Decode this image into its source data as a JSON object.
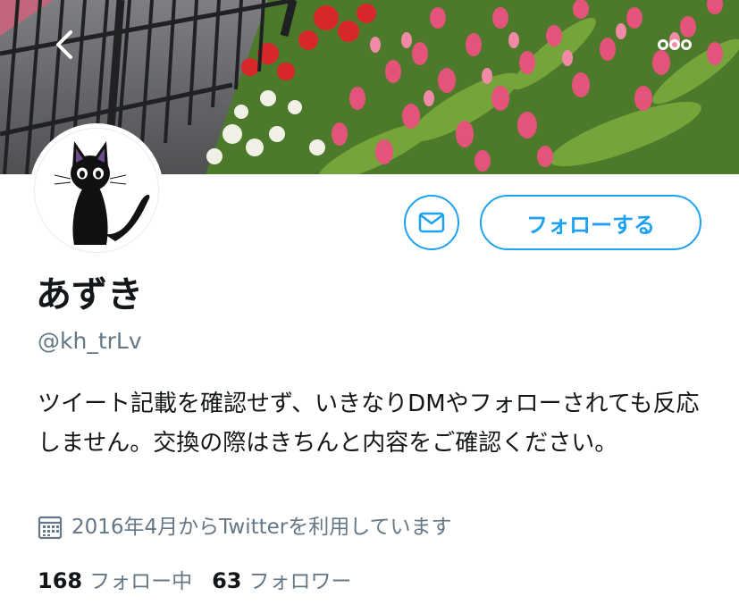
{
  "profile": {
    "display_name": "あずき",
    "handle": "@kh_trLv",
    "bio": "ツイート記載を確認せず、いきなりDMやフォローされても反応しません。交換の際はきちんと内容をご確認ください。",
    "joined": "2016年4月からTwitterを利用しています"
  },
  "actions": {
    "follow_label": "フォローする"
  },
  "stats": {
    "following_count": "168",
    "following_label": "フォロー中",
    "followers_count": "63",
    "followers_label": "フォロワー"
  },
  "icons": {
    "back": "chevron-left-icon",
    "more": "more-dots-icon",
    "dm": "envelope-icon",
    "calendar": "calendar-icon"
  },
  "colors": {
    "accent": "#1da1f2",
    "secondary_text": "#657786",
    "primary_text": "#14171a"
  }
}
